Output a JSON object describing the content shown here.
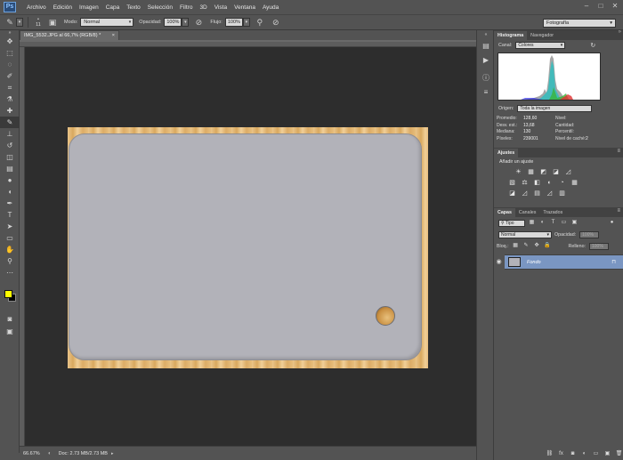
{
  "menubar": {
    "logo": "Ps",
    "items": [
      "Archivo",
      "Edición",
      "Imagen",
      "Capa",
      "Texto",
      "Selección",
      "Filtro",
      "3D",
      "Vista",
      "Ventana",
      "Ayuda"
    ]
  },
  "options": {
    "brush_size": "11",
    "mode_label": "Modo:",
    "mode_value": "Normal",
    "opacity_label": "Opacidad:",
    "opacity_value": "100%",
    "flow_label": "Flujo:",
    "flow_value": "100%",
    "workspace": "Fotografía"
  },
  "document": {
    "tab_title": "IMG_5532.JPG al 66,7% (RGB/8) *",
    "zoom": "66.67%",
    "doc_info": "Doc: 2.73 MB/2.73 MB"
  },
  "histogram": {
    "tabs": [
      "Histograma",
      "Navegador"
    ],
    "channel_label": "Canal:",
    "channel_value": "Colores",
    "source_label": "Origen:",
    "source_value": "Toda la imagen",
    "stats": [
      {
        "label": "Promedio:",
        "value": "128,60",
        "label2": "Nivel:",
        "value2": ""
      },
      {
        "label": "Desv. est.:",
        "value": "13,68",
        "label2": "Cantidad:",
        "value2": ""
      },
      {
        "label": "Mediana:",
        "value": "130",
        "label2": "Percentil:",
        "value2": ""
      },
      {
        "label": "Píxeles:",
        "value": "239001",
        "label2": "Nivel de caché:",
        "value2": "2"
      }
    ]
  },
  "adjustments": {
    "tab": "Ajustes",
    "title": "Añadir un ajuste",
    "row1": [
      "☀",
      "▦",
      "◩",
      "◪",
      "◿"
    ],
    "row2": [
      "▧",
      "⚖",
      "◧",
      "◐",
      "◔",
      "▦"
    ],
    "row3": [
      "◪",
      "◿",
      "▤",
      "◿",
      "▥"
    ]
  },
  "layers": {
    "tabs": [
      "Capas",
      "Canales",
      "Trazados"
    ],
    "filter_value": "Tipo",
    "blend_value": "Normal",
    "opacity_label": "Opacidad:",
    "opacity_value": "100%",
    "lock_label": "Bloq.:",
    "fill_label": "Relleno:",
    "fill_value": "100%",
    "layer_name": "Fondo"
  },
  "colors": {
    "foreground": "#ffff00",
    "background": "#000000",
    "card": "#b2b2b9",
    "selected_layer": "#7a96c2"
  }
}
